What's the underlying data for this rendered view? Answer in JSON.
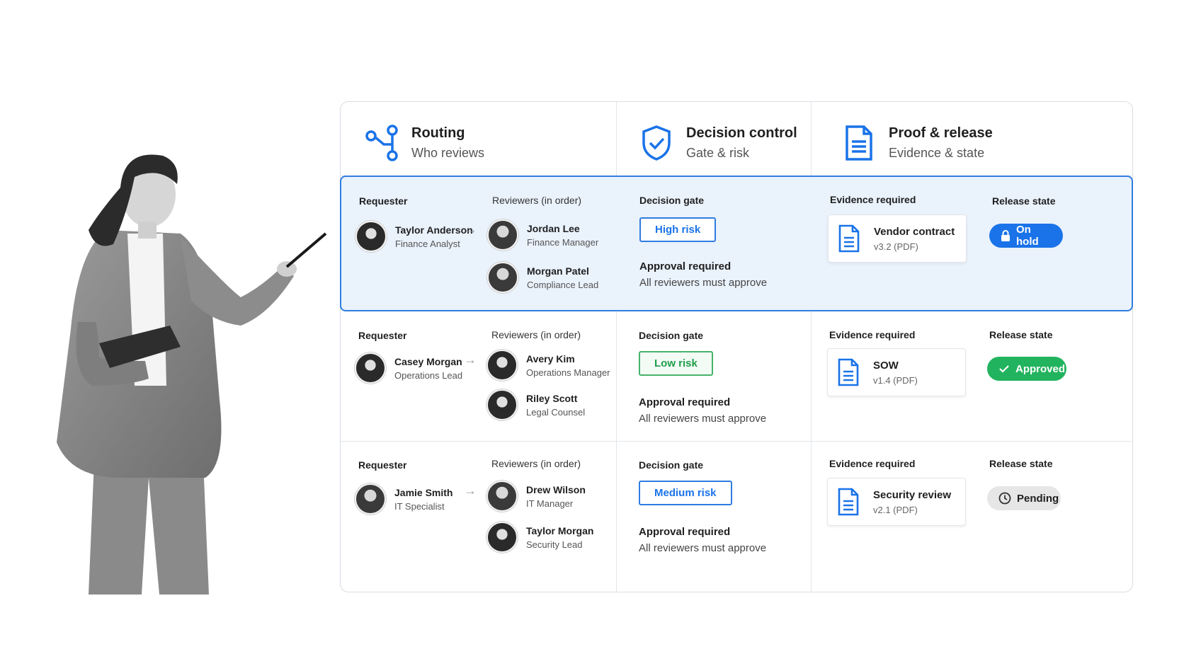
{
  "columns": [
    {
      "title": "Routing",
      "subtitle": "Who reviews",
      "icon": "routing-icon"
    },
    {
      "title": "Decision control",
      "subtitle": "Gate & risk",
      "icon": "shield-check-icon"
    },
    {
      "title": "Proof & release",
      "subtitle": "Evidence & state",
      "icon": "document-icon"
    }
  ],
  "rows": [
    {
      "requester_label": "Requester",
      "reviewers_label": "Reviewers (in order)",
      "requester": {
        "name": "Taylor Anderson",
        "role": "Finance Analyst"
      },
      "reviewers": [
        {
          "name": "Jordan Lee",
          "role": "Finance Manager"
        },
        {
          "name": "Morgan Patel",
          "role": "Compliance Lead"
        }
      ],
      "gate_label": "Decision gate",
      "risk": "High risk",
      "approval_title": "Approval required",
      "approval_sub": "All reviewers must approve",
      "evidence_label": "Evidence required",
      "evidence": {
        "name": "Vendor contract",
        "version": "v3.2 (PDF)"
      },
      "state_label": "Release state",
      "state": "On hold"
    },
    {
      "requester_label": "Requester",
      "reviewers_label": "Reviewers (in order)",
      "requester": {
        "name": "Casey Morgan",
        "role": "Operations Lead"
      },
      "reviewers": [
        {
          "name": "Avery Kim",
          "role": "Operations Manager"
        },
        {
          "name": "Riley Scott",
          "role": "Legal Counsel"
        }
      ],
      "gate_label": "Decision gate",
      "risk": "Low risk",
      "approval_title": "Approval required",
      "approval_sub": "All reviewers must approve",
      "evidence_label": "Evidence required",
      "evidence": {
        "name": "SOW",
        "version": "v1.4 (PDF)"
      },
      "state_label": "Release state",
      "state": "Approved"
    },
    {
      "requester_label": "Requester",
      "reviewers_label": "Reviewers (in order)",
      "requester": {
        "name": "Jamie Smith",
        "role": "IT Specialist"
      },
      "reviewers": [
        {
          "name": "Drew Wilson",
          "role": "IT Manager"
        },
        {
          "name": "Taylor Morgan",
          "role": "Security Lead"
        }
      ],
      "gate_label": "Decision gate",
      "risk": "Medium risk",
      "approval_title": "Approval required",
      "approval_sub": "All reviewers must approve",
      "evidence_label": "Evidence required",
      "evidence": {
        "name": "Security review",
        "version": "v2.1 (PDF)"
      },
      "state_label": "Release state",
      "state": "Pending"
    }
  ],
  "colors": {
    "accent": "#1a73e8",
    "approved": "#22b35e",
    "pending": "#e6e6e6",
    "active_row_bg": "#eaf2fc"
  }
}
